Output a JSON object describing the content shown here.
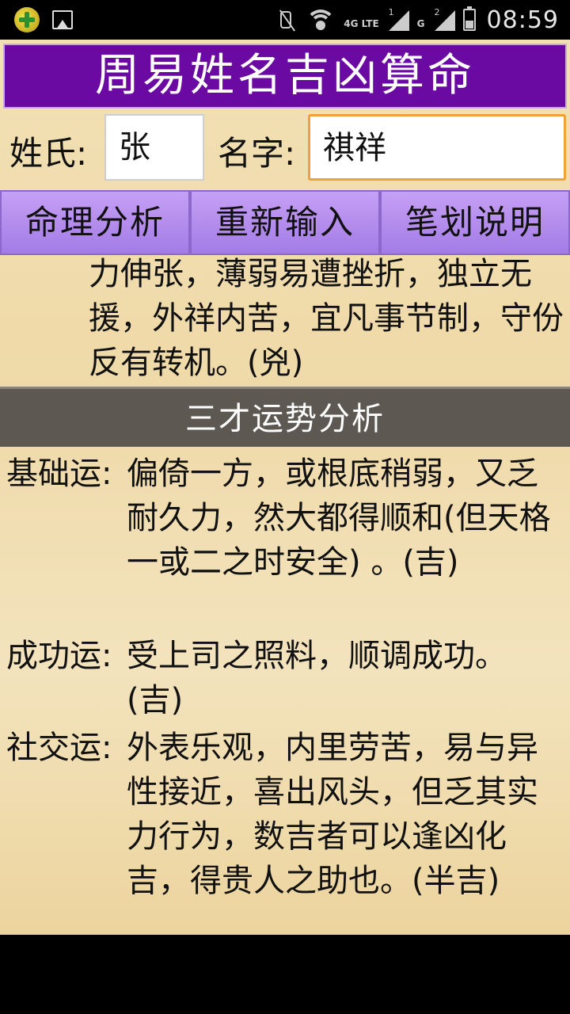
{
  "status_bar": {
    "network": "4G LTE",
    "sim1": "1",
    "sim2": "2",
    "sim2_net": "G",
    "time": "08:59"
  },
  "app": {
    "title": "周易姓名吉凶算命",
    "surname_label": "姓氏:",
    "surname_value": "张",
    "given_label": "名字:",
    "given_value": "祺祥",
    "buttons": {
      "analyze": "命理分析",
      "reset": "重新输入",
      "strokes": "笔划说明"
    },
    "previous_text": "力伸张，薄弱易遭挫折，独立无援，外祥内苦，宜凡事节制，守份反有转机。(兇)",
    "section_title": "三才运势分析",
    "rows": [
      {
        "key": "基础运:",
        "value": "偏倚一方，或根底稍弱，又乏耐久力，然大都得顺和(但天格一或二之时安全) 。(吉)"
      },
      {
        "key": "成功运:",
        "value": "受上司之照料，顺调成功。(吉)"
      },
      {
        "key": "社交运:",
        "value": "外表乐观，内里劳苦，易与异性接近，喜出风头，但乏其实力行为，数吉者可以逢凶化吉，得贵人之助也。(半吉)"
      }
    ]
  }
}
